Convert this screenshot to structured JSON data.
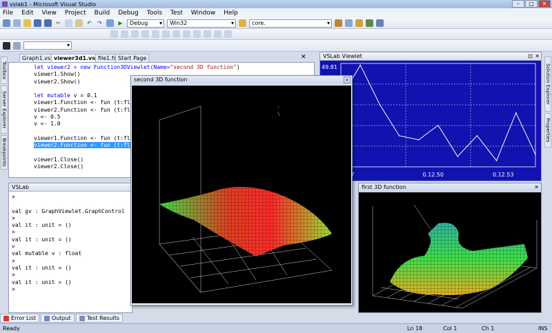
{
  "window": {
    "title": "vslab1 - Microsoft Visual Studio",
    "min": "–",
    "max": "□",
    "close": "✕"
  },
  "menu": [
    "File",
    "Edit",
    "View",
    "Project",
    "Build",
    "Debug",
    "Tools",
    "Test",
    "Window",
    "Help"
  ],
  "toolbar": {
    "config": "Debug",
    "platform": "Win32",
    "find": "core."
  },
  "tabs": [
    {
      "label": "Graph1.vslab",
      "active": false
    },
    {
      "label": "viewer3d1.vslab",
      "active": true
    },
    {
      "label": "file1.fs",
      "active": false
    },
    {
      "label": "Start Page",
      "active": false
    }
  ],
  "tab_close": "✕",
  "side_left": [
    "Toolbox",
    "Server Explorer",
    "Breakpoints"
  ],
  "side_right": [
    "Solution Explorer",
    "Properties"
  ],
  "code": {
    "l1a": "let viewer2 = new Function3DViewlet(Name=",
    "l1b": "\"second 3D function\"",
    "l1c": ")",
    "l2": "viewer1.Show()",
    "l3": "viewer2.Show()",
    "l4a": "let mutable",
    "l4b": " v = 0.1",
    "l5": "viewer1.Function <- fun (t:flo",
    "l6": "viewer2.Function <- fun (t:flo",
    "l7": "v <- 0.5",
    "l8": "v <- 1.0",
    "l9": "viewer1.Function <- fun (t:flo",
    "l10": "viewer2.Function <- fun (t:flo",
    "l11": "viewer1.Close()",
    "l12": "viewer2.Close()"
  },
  "console": {
    "title": "VSLab",
    "lines": [
      ">",
      "",
      "val gv : GraphViewlet.GraphControl",
      ">",
      "val it : unit = ()",
      ">",
      "val it : unit = ()",
      ">",
      "val mutable v : float",
      ">",
      "val it : unit = ()",
      ">",
      "val it : unit = ()",
      ">"
    ]
  },
  "viewlet": {
    "title": "VSLab Viewlet",
    "ymax_label": "49.81",
    "x_labels": [
      "2.47",
      "0.12.50",
      "0.12.53"
    ],
    "pin": "⊡",
    "close": "✕"
  },
  "chart_data": {
    "type": "line",
    "title": "VSLab Viewlet",
    "ylim": [
      0,
      49.81
    ],
    "x": [
      0,
      1,
      2,
      3,
      4,
      5,
      6,
      7,
      8,
      9,
      10
    ],
    "values": [
      33,
      49,
      30,
      15,
      13,
      20,
      5,
      15,
      3,
      26,
      6
    ],
    "grid": true,
    "y_tick": "49.81",
    "x_ticks": [
      "2.47",
      "0.12.50",
      "0.12.53"
    ]
  },
  "second3d": {
    "title": "second 3D function",
    "close": "x"
  },
  "first3d": {
    "title": "first 3D function",
    "close": "✕"
  },
  "bottom_tabs": [
    "Error List",
    "Output",
    "Test Results"
  ],
  "status": {
    "ready": "Ready",
    "ln": "Ln 18",
    "col": "Col 1",
    "ch": "Ch 1",
    "ins": "INS"
  },
  "colors": {
    "accent": "#1212b0",
    "selection": "#3399ff"
  }
}
